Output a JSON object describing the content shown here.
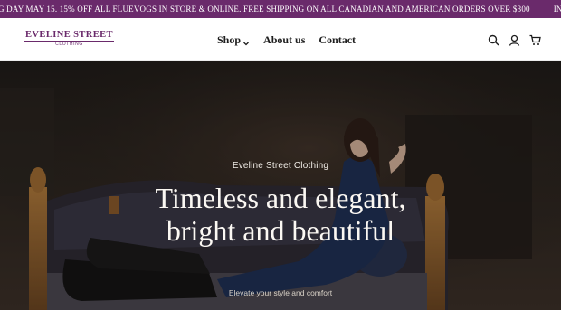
{
  "announcement": {
    "text_1": "G DAY MAY 15. 15% OFF ALL FLUEVOGS IN STORE & ONLINE. FREE SHIPPING ON ALL CANADIAN AND AMERICAN ORDERS OVER $300",
    "text_2": "INTERNATIONA"
  },
  "header": {
    "logo_main": "EVELINE STREET",
    "logo_sub": "CLOTHING",
    "nav": {
      "shop": "Shop",
      "about": "About us",
      "contact": "Contact"
    },
    "icons": [
      "search-icon",
      "account-icon",
      "cart-icon"
    ]
  },
  "hero": {
    "eyebrow": "Eveline Street Clothing",
    "headline": "Timeless and elegant, bright and beautiful",
    "tagline": "Elevate your style and comfort"
  },
  "colors": {
    "brand": "#6a2a6b",
    "nav_text": "#1d1d1d",
    "hero_text": "#fbf8f3"
  }
}
